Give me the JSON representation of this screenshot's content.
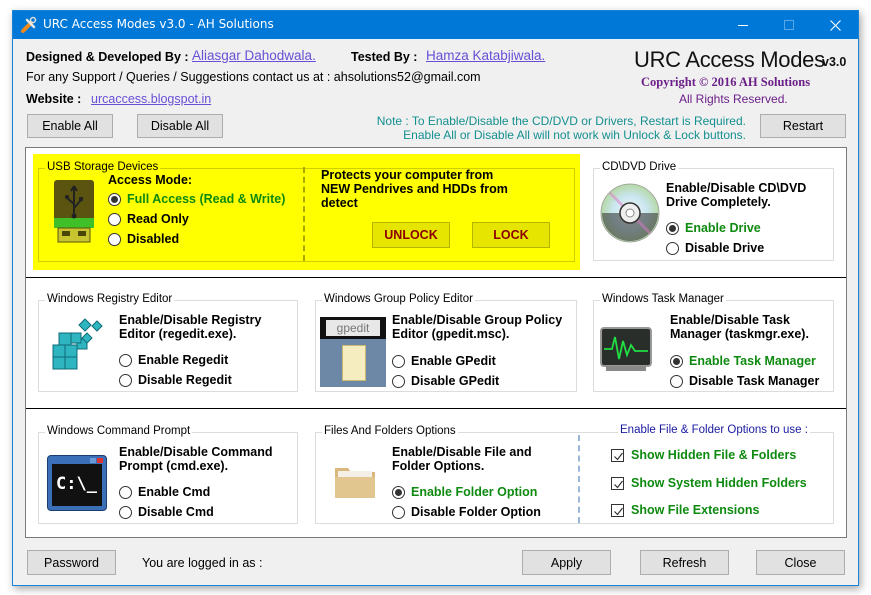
{
  "window": {
    "title": "URC Access Modes v3.0 - AH Solutions",
    "controls": {
      "minimize": "minimize",
      "maximize": "maximize",
      "close": "close"
    }
  },
  "header": {
    "designed_label": "Designed & Developed By :",
    "designer_name": "Aliasgar Dahodwala.",
    "tested_label": "Tested By :",
    "tester_name": "Hamza Katabjiwala.",
    "support_text": "For any Support / Queries / Suggestions contact us at : ahsolutions52@gmail.com",
    "website_label": "Website :",
    "website_link": "urcaccess.blogspot.in",
    "brand": "URC Access Modes",
    "version": "v3.0",
    "copyright": "Copyright © 2016 AH Solutions",
    "rights": "All Rights Reserved."
  },
  "toolbar": {
    "enable_all": "Enable All",
    "disable_all": "Disable All",
    "note_line1": "Note : To Enable/Disable the CD/DVD or Drivers, Restart is Required.",
    "note_line2": "Enable All or Disable All will not work wih Unlock & Lock buttons.",
    "restart": "Restart"
  },
  "usb": {
    "title": "USB Storage Devices",
    "access_mode_label": "Access Mode:",
    "options": [
      {
        "label": "Full Access (Read & Write)",
        "selected": true
      },
      {
        "label": "Read Only",
        "selected": false
      },
      {
        "label": "Disabled",
        "selected": false
      }
    ],
    "protect_text": "Protects your computer from NEW Pendrives and HDDs from detect",
    "unlock": "UNLOCK",
    "lock": "LOCK",
    "highlight_color": "#ffff00"
  },
  "cd": {
    "title": "CD\\DVD Drive",
    "desc": "Enable/Disable CD\\DVD Drive Completely.",
    "options": [
      {
        "label": "Enable Drive",
        "selected": true
      },
      {
        "label": "Disable Drive",
        "selected": false
      }
    ]
  },
  "regedit": {
    "title": "Windows Registry Editor",
    "desc": "Enable/Disable Registry Editor (regedit.exe).",
    "options": [
      {
        "label": "Enable Regedit",
        "selected": false
      },
      {
        "label": "Disable Regedit",
        "selected": false
      }
    ]
  },
  "gpedit": {
    "title": "Windows Group Policy Editor",
    "icon_text": "gpedit",
    "desc": "Enable/Disable Group Policy Editor (gpedit.msc).",
    "options": [
      {
        "label": "Enable GPedit",
        "selected": false
      },
      {
        "label": "Disable GPedit",
        "selected": false
      }
    ]
  },
  "taskmgr": {
    "title": "Windows Task Manager",
    "desc": "Enable/Disable Task Manager (taskmgr.exe).",
    "options": [
      {
        "label": "Enable Task Manager",
        "selected": true
      },
      {
        "label": "Disable Task Manager",
        "selected": false
      }
    ]
  },
  "cmd": {
    "title": "Windows Command Prompt",
    "icon_text": "C:\\_",
    "desc": "Enable/Disable Command Prompt (cmd.exe).",
    "options": [
      {
        "label": "Enable Cmd",
        "selected": false
      },
      {
        "label": "Disable Cmd",
        "selected": false
      }
    ]
  },
  "folders": {
    "title": "Files And Folders Options",
    "desc": "Enable/Disable File and Folder Options.",
    "options": [
      {
        "label": "Enable Folder Option",
        "selected": true
      },
      {
        "label": "Disable Folder Option",
        "selected": false
      }
    ],
    "sub_title": "Enable File & Folder Options to use :",
    "checks": [
      {
        "label": "Show Hidden File & Folders",
        "checked": true
      },
      {
        "label": "Show System Hidden Folders",
        "checked": true
      },
      {
        "label": "Show File Extensions",
        "checked": true
      }
    ]
  },
  "footer": {
    "password": "Password",
    "logged_in": "You are logged in as :",
    "apply": "Apply",
    "refresh": "Refresh",
    "close": "Close"
  },
  "colors": {
    "titlebar": "#0078d7",
    "selected_option": "#0e8a10",
    "link": "#6a4fd6",
    "note": "#148f8f",
    "copyright": "#6b1f88",
    "lock_text": "#8b0000"
  }
}
